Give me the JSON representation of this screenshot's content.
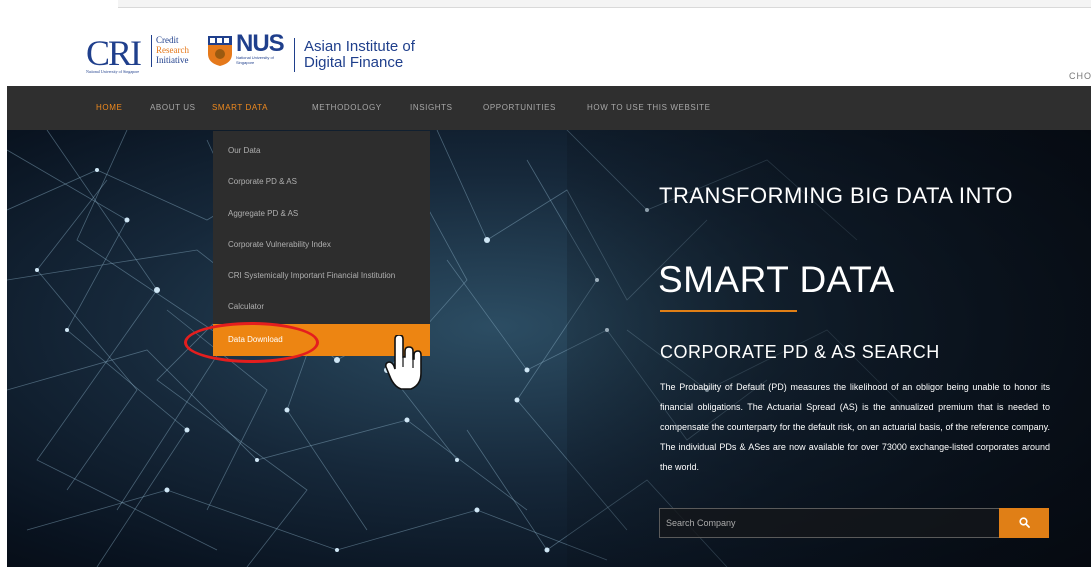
{
  "header": {
    "cri_logo": {
      "letters": "CRI",
      "word1": "Credit",
      "word2": "Research",
      "word3": "Initiative",
      "subtext": "National University of Singapore"
    },
    "nus_logo": {
      "text": "NUS",
      "small": "National University of Singapore"
    },
    "institute_line1": "Asian Institute of",
    "institute_line2": "Digital Finance",
    "choose": "CHO"
  },
  "nav": {
    "items": [
      {
        "label": "HOME",
        "active": true
      },
      {
        "label": "ABOUT US",
        "active": false
      },
      {
        "label": "SMART DATA",
        "active": true
      },
      {
        "label": "METHODOLOGY",
        "active": false
      },
      {
        "label": "INSIGHTS",
        "active": false
      },
      {
        "label": "OPPORTUNITIES",
        "active": false
      },
      {
        "label": "HOW TO USE THIS WEBSITE",
        "active": false
      }
    ]
  },
  "dropdown": {
    "items": [
      {
        "label": "Our Data"
      },
      {
        "label": "Corporate PD & AS"
      },
      {
        "label": "Aggregate PD & AS"
      },
      {
        "label": "Corporate Vulnerability Index"
      },
      {
        "label": "CRI Systemically Important Financial Institution"
      },
      {
        "label": "Calculator"
      },
      {
        "label": "Data Download",
        "highlighted": true
      }
    ]
  },
  "hero": {
    "title_line1": "TRANSFORMING BIG DATA INTO",
    "title_line2": "SMART DATA",
    "subtitle": "CORPORATE PD & AS SEARCH",
    "description": "The Probability of Default (PD) measures the likelihood of an obligor being unable to honor its financial obligations. The Actuarial Spread (AS) is the annualized premium that is needed to compensate the counterparty for the default risk, on an actuarial basis, of the reference company. The individual PDs & ASes are now available for over 73000 exchange-listed corporates around the world.",
    "search_placeholder": "Search Company",
    "search_icon": "search-icon"
  },
  "colors": {
    "accent": "#e07f16",
    "nav_bg": "#2f2f2f",
    "brand_blue": "#1f3f8c",
    "annotation_red": "#e41e1e"
  }
}
